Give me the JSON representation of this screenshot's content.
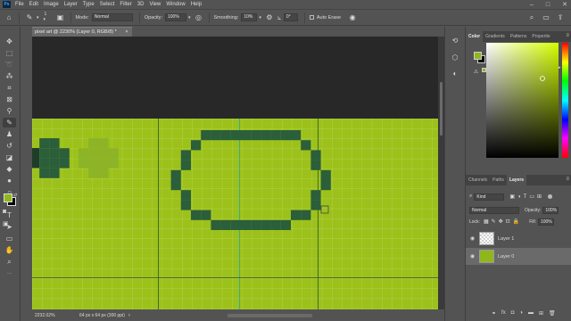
{
  "menubar": {
    "logo": "Ps",
    "items": [
      "File",
      "Edit",
      "Image",
      "Layer",
      "Type",
      "Select",
      "Filter",
      "3D",
      "View",
      "Window",
      "Help"
    ],
    "window_controls": [
      "–",
      "□",
      "✕"
    ]
  },
  "options": {
    "brush_size": "1",
    "mode_label": "Mode:",
    "mode_value": "Normal",
    "opacity_label": "Opacity:",
    "opacity_value": "100%",
    "smoothing_label": "Smoothing:",
    "smoothing_value": "10%",
    "angle_value": "0°",
    "auto_erase_label": "Auto Erase"
  },
  "document": {
    "tab_title": "pixel art @ 2230% (Layer 0, RGB/8) *",
    "tab_close": "×",
    "zoom": "2232.02%",
    "doc_info": "64 px x 64 px (300 ppi)"
  },
  "colors": {
    "canvas_bg": "#9cc11a",
    "pixel_dark": "#2b5e3a",
    "pixel_light": "#8cb328",
    "foreground": "#8fb71c",
    "background": "#000000",
    "pasteboard": "#282828"
  },
  "color_panel": {
    "tabs": [
      "Color",
      "Gradients",
      "Patterns",
      "Propertie"
    ],
    "active_tab": "Color"
  },
  "layers_panel": {
    "tabs": [
      "Channels",
      "Paths",
      "Layers"
    ],
    "active_tab": "Layers",
    "filter_kind": "Kind",
    "blend_mode": "Normal",
    "opacity_label": "Opacity:",
    "opacity_value": "100%",
    "lock_label": "Lock:",
    "fill_label": "Fill:",
    "fill_value": "100%",
    "layers": [
      {
        "name": "Layer 1",
        "selected": false
      },
      {
        "name": "Layer 0",
        "selected": true
      }
    ]
  }
}
